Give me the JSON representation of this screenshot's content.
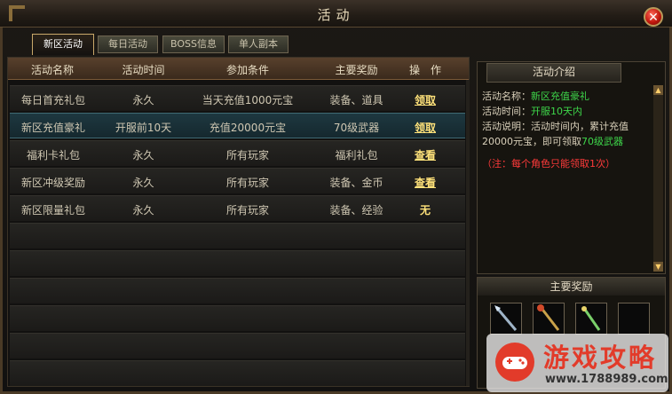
{
  "window": {
    "title": "活动",
    "close_label": "✕"
  },
  "tabs": [
    {
      "label": "新区活动",
      "active": true
    },
    {
      "label": "每日活动",
      "active": false
    },
    {
      "label": "BOSS信息",
      "active": false
    },
    {
      "label": "单人副本",
      "active": false
    }
  ],
  "table": {
    "headers": [
      "活动名称",
      "活动时间",
      "参加条件",
      "主要奖励",
      "操　作"
    ],
    "rows": [
      {
        "name": "每日首充礼包",
        "time": "永久",
        "condition": "当天充值1000元宝",
        "reward": "装备、道具",
        "action": "领取"
      },
      {
        "name": "新区充值豪礼",
        "time": "开服前10天",
        "condition": "充值20000元宝",
        "reward": "70级武器",
        "action": "领取"
      },
      {
        "name": "福利卡礼包",
        "time": "永久",
        "condition": "所有玩家",
        "reward": "福利礼包",
        "action": "查看"
      },
      {
        "name": "新区冲级奖励",
        "time": "永久",
        "condition": "所有玩家",
        "reward": "装备、金币",
        "action": "查看"
      },
      {
        "name": "新区限量礼包",
        "time": "永久",
        "condition": "所有玩家",
        "reward": "装备、经验",
        "action": "无"
      }
    ],
    "selected_row": 1
  },
  "intro": {
    "title": "活动介绍",
    "name_label": "活动名称：",
    "name_value": "新区充值豪礼",
    "time_label": "活动时间：",
    "time_value": "开服10天内",
    "desc_label": "活动说明：",
    "desc_text": "活动时间内，累计充值20000元宝，即可领取",
    "desc_highlight": "70级武器",
    "note": "（注：每个角色只能领取1次）"
  },
  "rewards": {
    "title": "主要奖励"
  },
  "watermark": {
    "title": "游戏攻略",
    "url": "www.1788989.com"
  },
  "colors": {
    "accent_green": "#3ed64a",
    "note_red": "#ff3a3a",
    "link_yellow": "#ffe27a"
  }
}
